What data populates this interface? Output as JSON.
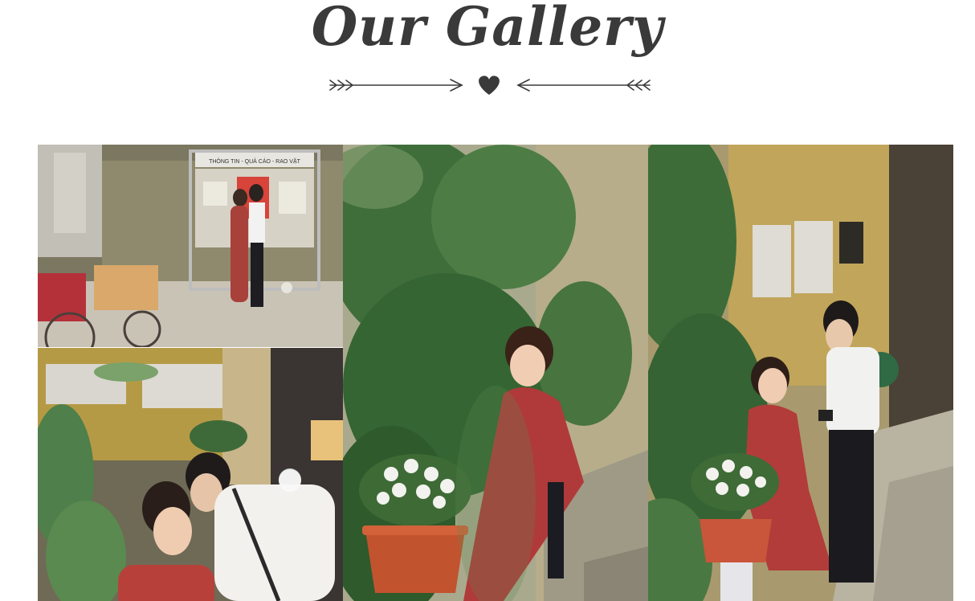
{
  "header": {
    "title": "Our Gallery"
  },
  "icons": {
    "divider": "arrow-heart-divider",
    "heart": "heart-icon"
  },
  "colors": {
    "title": "#3a3a3a",
    "foliage": "#3e6e3a",
    "dress": "#b23a3a"
  },
  "gallery": {
    "photos": [
      {
        "name": "couple-at-notice-board",
        "sign_text": "THÔNG TIN - QUÀ CÁO - RAO VẶT"
      },
      {
        "name": "bride-with-flowers-among-leaves"
      },
      {
        "name": "groom-kissing-bride"
      },
      {
        "name": "couple-by-staircase-with-camera"
      }
    ]
  }
}
